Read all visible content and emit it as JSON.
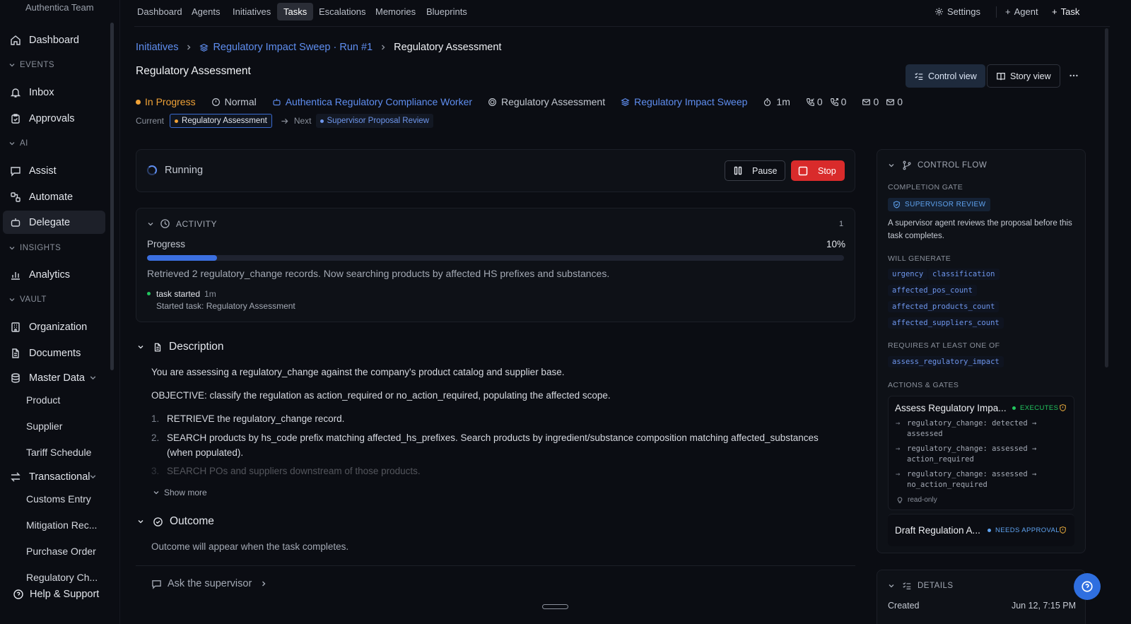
{
  "sidebar": {
    "team": "Authentica Team",
    "items": {
      "dashboard": "Dashboard",
      "inbox": "Inbox",
      "approvals": "Approvals",
      "assist": "Assist",
      "automate": "Automate",
      "delegate": "Delegate",
      "analytics": "Analytics",
      "organization": "Organization",
      "documents": "Documents",
      "master_data": "Master Data",
      "transactional": "Transactional"
    },
    "sections": {
      "events": "EVENTS",
      "ai": "AI",
      "insights": "INSIGHTS",
      "vault": "VAULT"
    },
    "master_data_items": [
      "Product",
      "Supplier",
      "Tariff Schedule"
    ],
    "transactional_items": [
      "Customs Entry",
      "Mitigation Rec...",
      "Purchase Order",
      "Regulatory Ch..."
    ],
    "help": "Help & Support"
  },
  "topnav": {
    "tabs": [
      "Dashboard",
      "Agents",
      "Initiatives",
      "Tasks",
      "Escalations",
      "Memories",
      "Blueprints"
    ],
    "settings": "Settings",
    "agent": "Agent",
    "task": "Task"
  },
  "breadcrumb": {
    "root": "Initiatives",
    "run": "Regulatory Impact Sweep · Run #1",
    "current": "Regulatory Assessment"
  },
  "page": {
    "title": "Regulatory Assessment",
    "control_view": "Control view",
    "story_view": "Story view"
  },
  "meta": {
    "status": "In Progress",
    "priority": "Normal",
    "worker": "Authentica Regulatory Compliance Worker",
    "stage": "Regulatory Assessment",
    "initiative": "Regulatory Impact Sweep",
    "duration": "1m",
    "calls_in": "0",
    "calls_out": "0",
    "mail_in": "0",
    "mail_out": "0",
    "status_color": "#f0a237",
    "link_color": "#5f8ef0"
  },
  "stage_bar": {
    "current_label": "Current",
    "current": "Regulatory Assessment",
    "next_label": "Next",
    "next": "Supervisor Proposal Review"
  },
  "run": {
    "status": "Running",
    "pause": "Pause",
    "stop": "Stop"
  },
  "activity": {
    "title": "ACTIVITY",
    "count": "1",
    "progress_label": "Progress",
    "progress_pct": "10%",
    "progress_value": 0.1,
    "message": "Retrieved 2 regulatory_change records. Now searching products by affected HS prefixes and substances.",
    "event_title": "task started",
    "event_time": "1m",
    "event_desc": "Started task: Regulatory Assessment"
  },
  "description": {
    "title": "Description",
    "p1": "You are assessing a regulatory_change against the company's product catalog and supplier base.",
    "p2": "OBJECTIVE: classify the regulation as action_required or no_action_required, populating the affected scope.",
    "steps": [
      {
        "num": "1.",
        "text": "RETRIEVE the regulatory_change record."
      },
      {
        "num": "2.",
        "text": "SEARCH products by hs_code prefix matching affected_hs_prefixes. Search products by ingredient/substance composition matching affected_substances (when populated)."
      },
      {
        "num": "3.",
        "text": "SEARCH POs and suppliers downstream of those products."
      }
    ],
    "show_more": "Show more"
  },
  "outcome": {
    "title": "Outcome",
    "text": "Outcome will appear when the task completes."
  },
  "ask": "Ask the supervisor",
  "control_flow": {
    "title": "CONTROL FLOW",
    "gate_label": "COMPLETION GATE",
    "gate_badge": "SUPERVISOR REVIEW",
    "gate_text": "A supervisor agent reviews the proposal before this task completes.",
    "generate_label": "WILL GENERATE",
    "generate": [
      "urgency",
      "classification",
      "affected_pos_count",
      "affected_products_count",
      "affected_suppliers_count"
    ],
    "requires_label": "REQUIRES AT LEAST ONE OF",
    "requires": [
      "assess_regulatory_impact"
    ],
    "actions_label": "ACTIONS & GATES",
    "actions": [
      {
        "title": "Assess Regulatory Impa...",
        "badge": "EXECUTES",
        "transitions": [
          [
            "regulatory_change: detected →",
            "assessed"
          ],
          [
            "regulatory_change: assessed →",
            "action_required"
          ],
          [
            "regulatory_change: assessed →",
            "no_action_required"
          ]
        ],
        "note": "read-only"
      },
      {
        "title": "Draft Regulation A...",
        "badge": "NEEDS APPROVAL"
      }
    ]
  },
  "details": {
    "title": "DETAILS",
    "created_label": "Created",
    "created_value": "Jun 12, 7:15 PM"
  }
}
